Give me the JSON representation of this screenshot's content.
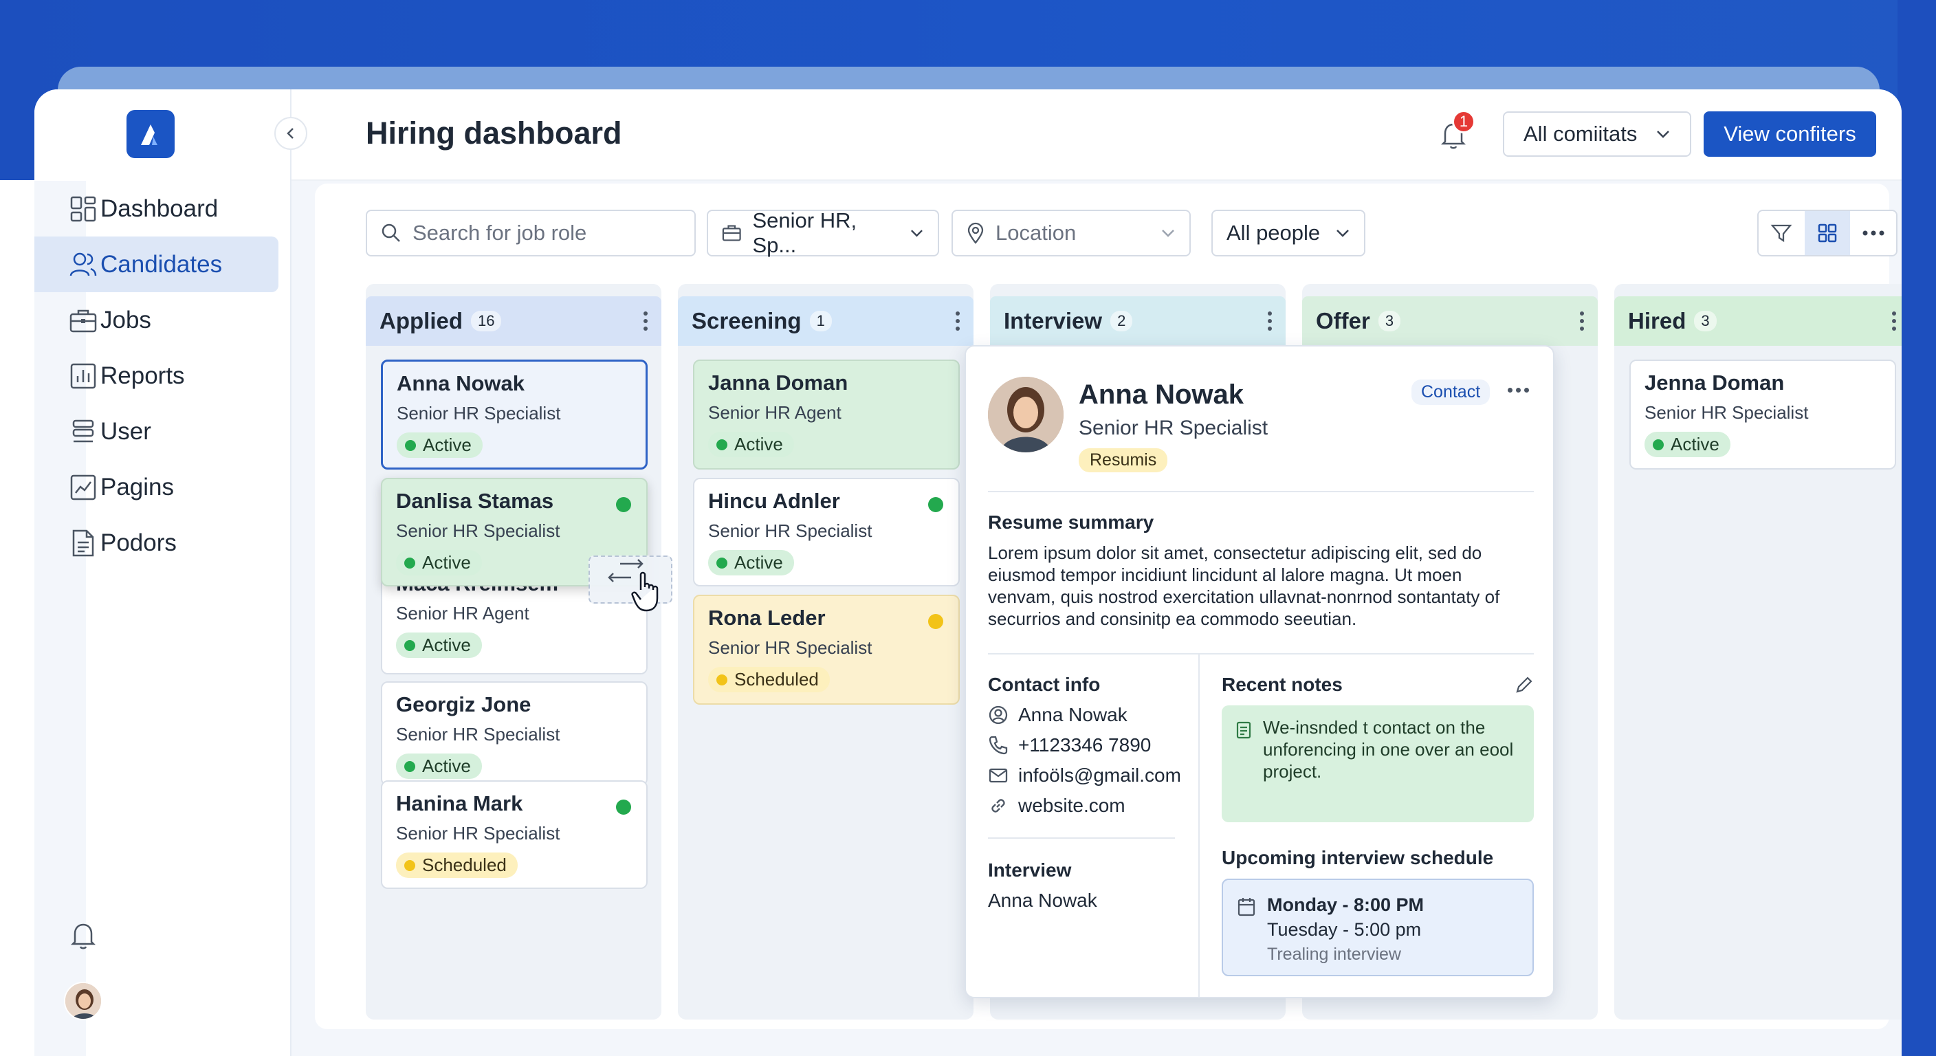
{
  "app": {
    "title": "Hiring dashboard"
  },
  "header": {
    "notification_count": "1",
    "dropdown_label": "All comiitats",
    "primary_button": "View confiters"
  },
  "sidebar": {
    "items": [
      {
        "label": "Dashboard",
        "icon": "dashboard-icon"
      },
      {
        "label": "Candidates",
        "icon": "users-icon",
        "active": true
      },
      {
        "label": "Jobs",
        "icon": "briefcase-icon"
      },
      {
        "label": "Reports",
        "icon": "bar-chart-icon"
      },
      {
        "label": "User",
        "icon": "stack-icon"
      },
      {
        "label": "Pagins",
        "icon": "line-chart-icon"
      },
      {
        "label": "Podors",
        "icon": "document-icon"
      }
    ]
  },
  "filters": {
    "search_placeholder": "Search for job role",
    "role": "Senior HR, Sp...",
    "location": "Location",
    "people": "All people"
  },
  "columns": [
    {
      "title": "Applied",
      "count": "16",
      "color": "#d6e2f7",
      "cards": [
        {
          "name": "Anna Nowak",
          "role": "Senior HR Specialist",
          "status": "Active"
        },
        {
          "name": "Danlisa Stamas",
          "role": "Senior HR Specialist",
          "status": "Active"
        },
        {
          "name": "Maca Rreimsem",
          "role": "Senior HR Agent",
          "status": "Active"
        },
        {
          "name": "Georgiz Jone",
          "role": "Senior HR Specialist",
          "status": "Active"
        },
        {
          "name": "Hanina Mark",
          "role": "Senior HR Specialist",
          "status": "Scheduled"
        }
      ]
    },
    {
      "title": "Screening",
      "count": "1",
      "color": "#d3e6f9",
      "cards": [
        {
          "name": "Janna Doman",
          "role": "Senior HR Agent",
          "status": "Active"
        },
        {
          "name": "Hincu Adnler",
          "role": "Senior HR Specialist",
          "status": "Active"
        },
        {
          "name": "Rona Leder",
          "role": "Senior HR Specialist",
          "status": "Scheduled"
        }
      ]
    },
    {
      "title": "Interview",
      "count": "2",
      "color": "#d5ecf2",
      "cards": []
    },
    {
      "title": "Offer",
      "count": "3",
      "color": "#d9efdf",
      "cards": []
    },
    {
      "title": "Hired",
      "count": "3",
      "color": "#d4efd9",
      "cards": [
        {
          "name": "Jenna Doman",
          "role": "Senior HR Specialist",
          "status": "Active"
        }
      ]
    }
  ],
  "detail": {
    "name": "Anna Nowak",
    "role": "Senior HR Specialist",
    "tag": "Resumis",
    "contact_button": "Contact",
    "summary_title": "Resume summary",
    "summary": "Lorem ipsum dolor sit amet, consectetur adipiscing elit, sed do eiusmod tempor incidiunt lincidunt al lalore magna. Ut moen venvam, quis nostrod exercitation ullavnat-nonrnod sontantaty of securrios and consinitp ea commodo seeutian.",
    "contact_title": "Contact info",
    "contact_name": "Anna Nowak",
    "phone": "+1123346 7890",
    "email": "infoöls@gmail.com",
    "website": "website.com",
    "interview_title": "Interview",
    "interview_name": "Anna Nowak",
    "notes_title": "Recent notes",
    "note": "We-insnded t contact on the unforencing in one over an eool project.",
    "schedule_title": "Upcoming interview schedule",
    "schedule_line1": "Monday - 8:00 PM",
    "schedule_line2": "Tuesday - 5:00 pm",
    "schedule_line3": "Trealing interview"
  },
  "colors": {
    "primary": "#1b55c4",
    "active": "#23a94e",
    "scheduled": "#f2c318",
    "badge": "#e53935"
  }
}
